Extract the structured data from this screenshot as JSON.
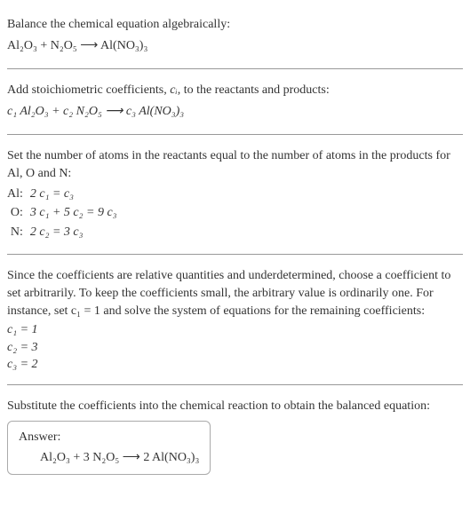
{
  "section1": {
    "line1": "Balance the chemical equation algebraically:",
    "eq": "Al₂O₃ + N₂O₅  ⟶  Al(NO₃)₃"
  },
  "section2": {
    "line1_pre": "Add stoichiometric coefficients, ",
    "line1_var": "cᵢ",
    "line1_post": ", to the reactants and products:",
    "eq": "c₁ Al₂O₃ + c₂ N₂O₅  ⟶  c₃ Al(NO₃)₃"
  },
  "section3": {
    "line1": "Set the number of atoms in the reactants equal to the number of atoms in the products for Al, O and N:",
    "rows": [
      {
        "label": "Al:",
        "eq": "2 c₁ = c₃"
      },
      {
        "label": "O:",
        "eq": "3 c₁ + 5 c₂ = 9 c₃"
      },
      {
        "label": "N:",
        "eq": "2 c₂ = 3 c₃"
      }
    ]
  },
  "section4": {
    "line1": "Since the coefficients are relative quantities and underdetermined, choose a coefficient to set arbitrarily. To keep the coefficients small, the arbitrary value is ordinarily one. For instance, set c₁ = 1 and solve the system of equations for the remaining coefficients:",
    "coeffs": [
      "c₁ = 1",
      "c₂ = 3",
      "c₃ = 2"
    ]
  },
  "section5": {
    "line1": "Substitute the coefficients into the chemical reaction to obtain the balanced equation:",
    "answer_label": "Answer:",
    "answer_eq": "Al₂O₃ + 3 N₂O₅  ⟶  2 Al(NO₃)₃"
  },
  "chart_data": {
    "type": "table",
    "title": "Balancing Al2O3 + N2O5 -> Al(NO3)3",
    "reactants": [
      "Al2O3",
      "N2O5"
    ],
    "products": [
      "Al(NO3)3"
    ],
    "unknown_coefficients": [
      "c1",
      "c2",
      "c3"
    ],
    "atom_balance_equations": {
      "Al": "2 c1 = c3",
      "O": "3 c1 + 5 c2 = 9 c3",
      "N": "2 c2 = 3 c3"
    },
    "solution": {
      "c1": 1,
      "c2": 3,
      "c3": 2
    },
    "balanced_equation": "Al2O3 + 3 N2O5 -> 2 Al(NO3)3"
  }
}
